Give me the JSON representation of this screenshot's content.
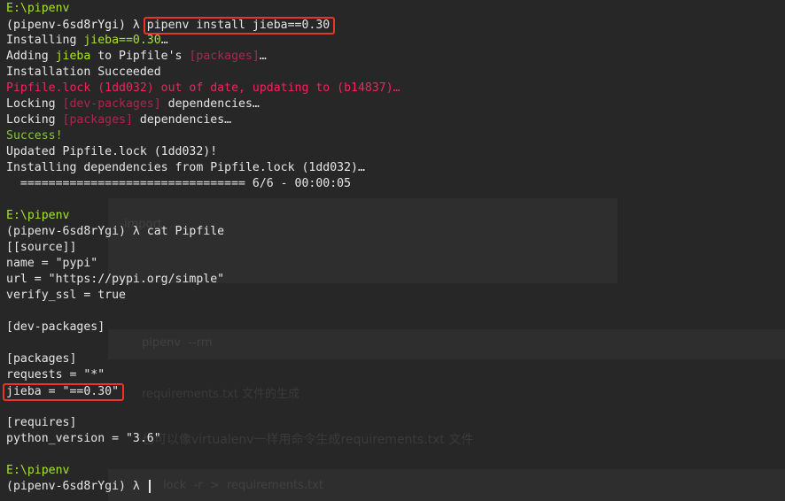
{
  "lines": {
    "l1_path": "E:\\pipenv",
    "l2_prompt": "(pipenv-6sd8rYgi) λ ",
    "l2_cmd": "pipenv install jieba==0.30",
    "l3_a": "Installing ",
    "l3_b": "jieba==0.30",
    "l3_c": "…",
    "l4_a": "Adding ",
    "l4_b": "jieba",
    "l4_c": " to Pipfile's ",
    "l4_d": "[packages]",
    "l4_e": "…",
    "l5": "Installation Succeeded",
    "l6": "Pipfile.lock (1dd032) out of date, updating to (b14837)…",
    "l7_a": "Locking ",
    "l7_b": "[dev-packages]",
    "l7_c": " dependencies…",
    "l8_a": "Locking ",
    "l8_b": "[packages]",
    "l8_c": " dependencies…",
    "l9": "Success!",
    "l10": "Updated Pipfile.lock (1dd032)!",
    "l11": "Installing dependencies from Pipfile.lock (1dd032)…",
    "l12": "  ================================ 6/6 - 00:00:05",
    "l14_path": "E:\\pipenv",
    "l15": "(pipenv-6sd8rYgi) λ cat Pipfile",
    "l16": "[[source]]",
    "l17": "name = \"pypi\"",
    "l18": "url = \"https://pypi.org/simple\"",
    "l19": "verify_ssl = true",
    "l21": "[dev-packages]",
    "l23": "[packages]",
    "l24": "requests = \"*\"",
    "l25": "jieba = \"==0.30\"",
    "l27": "[requires]",
    "l28": "python_version = \"3.6\"",
    "l30_path": "E:\\pipenv",
    "l31_prompt": "(pipenv-6sd8rYgi) λ "
  },
  "ghost": {
    "g1": "pipenv  --rm",
    "g2": "requirements.txt 文件的生成",
    "g3": "也可以像virtualenv一样用命令生成requirements.txt 文件",
    "g4": "lock  -r  >  requirements.txt",
    "g5": "import  ..."
  },
  "colors": {
    "background": "#272727",
    "text": "#e6e6e6",
    "path_green": "#a6e22e",
    "success_green": "#87c540",
    "error_red": "#f0245c",
    "bracket_red": "#a8294f",
    "highlight_box": "#e8352a"
  }
}
